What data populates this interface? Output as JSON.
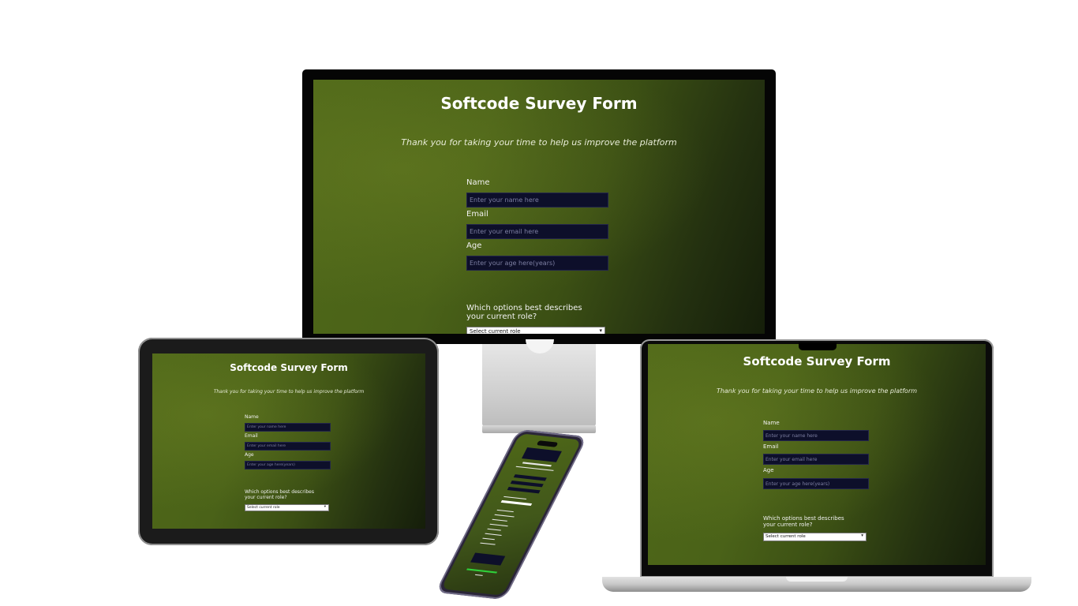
{
  "form": {
    "title": "Softcode Survey Form",
    "description": "Thank you for taking your time to help us improve the platform",
    "name_label": "Name",
    "name_placeholder": "Enter your name here",
    "email_label": "Email",
    "email_placeholder": "Enter your email here",
    "age_label": "Age",
    "age_placeholder": "Enter your age here(years)",
    "role_question": "Which options best describes your current role?",
    "role_select_value": "Select current role"
  },
  "colors": {
    "bg_start": "#4f6819",
    "bg_end": "#151e0a",
    "input_bg": "#0d0f2a",
    "input_text": "#7d7fa2",
    "submit_green": "#2fd13a"
  },
  "devices": [
    "desktop-monitor",
    "tablet",
    "laptop",
    "smartphone"
  ]
}
